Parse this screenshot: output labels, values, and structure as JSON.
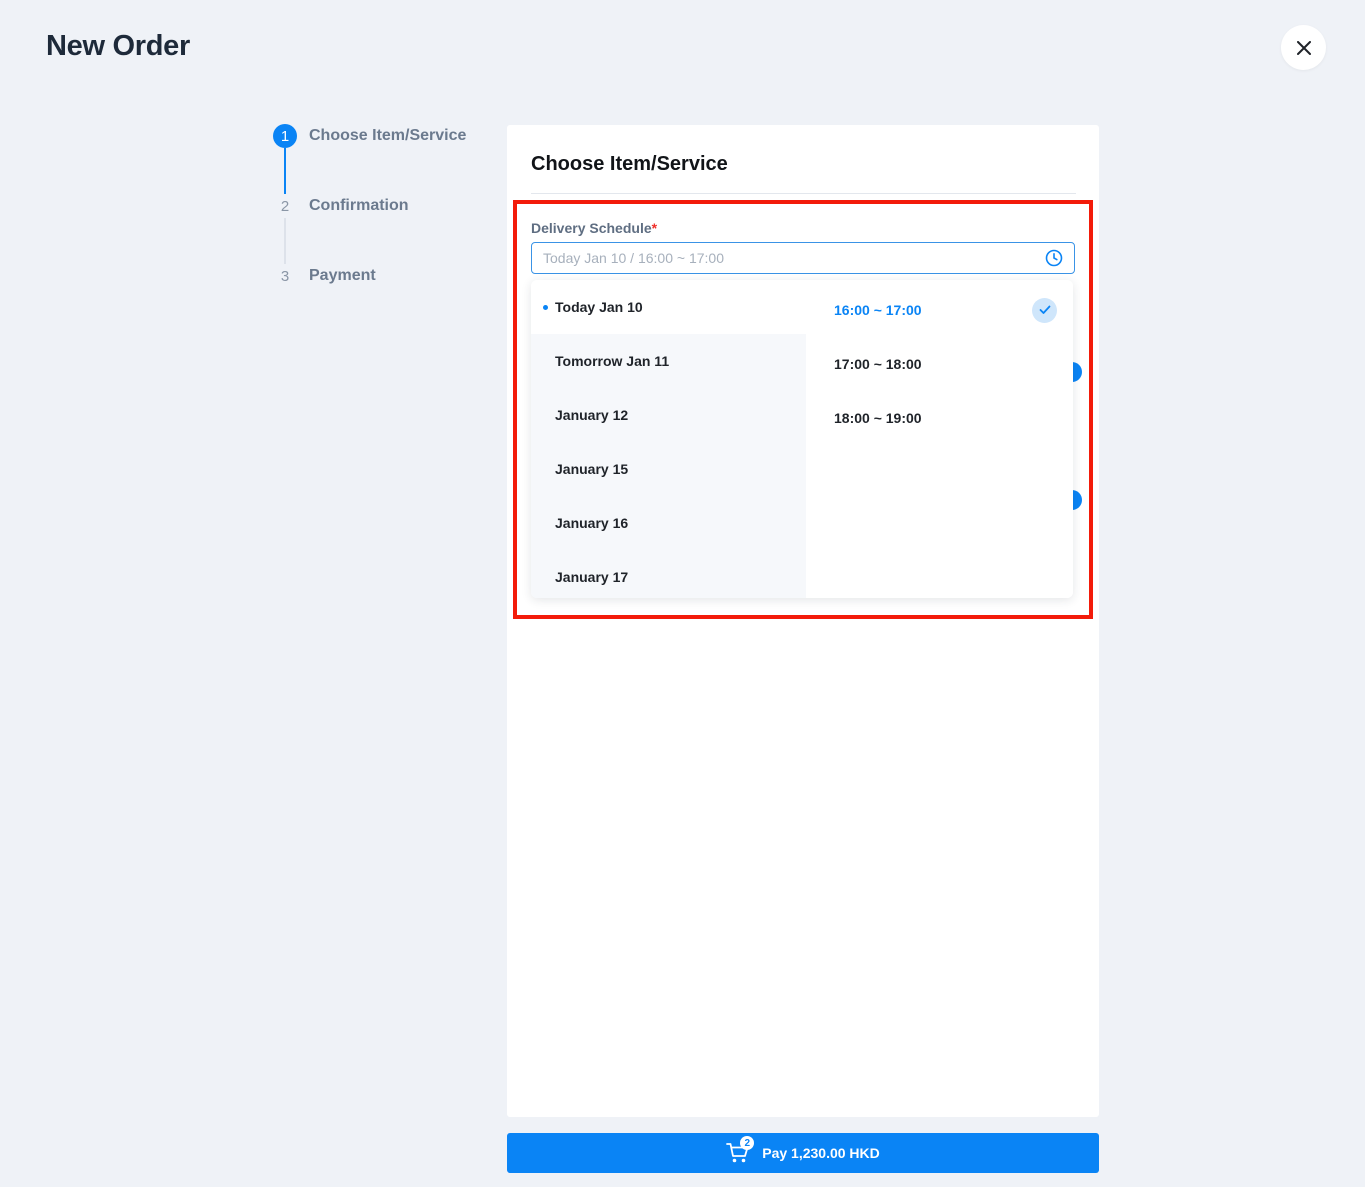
{
  "page": {
    "title": "New Order"
  },
  "stepper": {
    "steps": [
      {
        "number": "1",
        "label": "Choose Item/Service"
      },
      {
        "number": "2",
        "label": "Confirmation"
      },
      {
        "number": "3",
        "label": "Payment"
      }
    ]
  },
  "card": {
    "title": "Choose Item/Service"
  },
  "schedule": {
    "label": "Delivery Schedule",
    "required_mark": "*",
    "placeholder": "Today Jan 10 / 16:00 ~ 17:00",
    "dates": [
      "Today Jan 10",
      "Tomorrow Jan 11",
      "January 12",
      "January 15",
      "January 16",
      "January 17"
    ],
    "selected_date": "Today Jan 10",
    "times": [
      "16:00 ~ 17:00",
      "17:00 ~ 18:00",
      "18:00 ~ 19:00"
    ],
    "selected_time": "16:00 ~ 17:00"
  },
  "pay": {
    "cart_count": "2",
    "label": "Pay 1,230.00 HKD"
  },
  "colors": {
    "accent": "#0a84f5",
    "highlight": "#f31b0a",
    "background": "#eff2f7"
  }
}
